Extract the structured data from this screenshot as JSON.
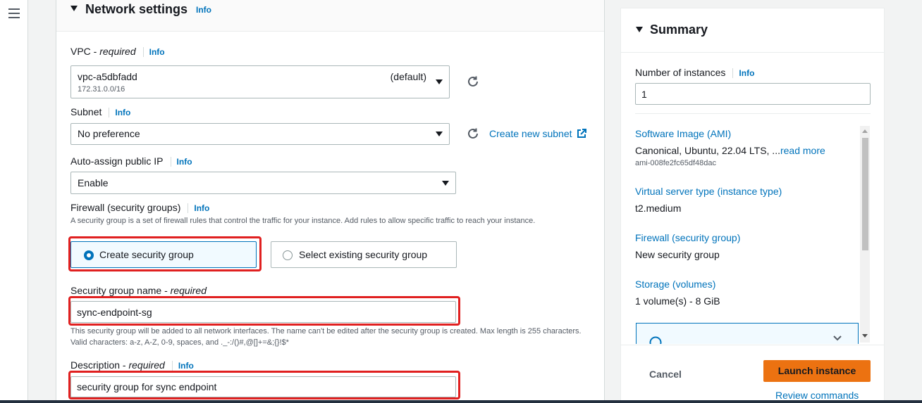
{
  "network": {
    "title": "Network settings",
    "info": "Info",
    "vpc": {
      "label": "VPC - ",
      "required": "required",
      "info": "Info",
      "value": "vpc-a5dbfadd",
      "tag": "(default)",
      "cidr": "172.31.0.0/16"
    },
    "subnet": {
      "label": "Subnet",
      "info": "Info",
      "value": "No preference",
      "create_link": "Create new subnet"
    },
    "public_ip": {
      "label": "Auto-assign public IP",
      "info": "Info",
      "value": "Enable"
    },
    "firewall": {
      "label": "Firewall (security groups)",
      "info": "Info",
      "help": "A security group is a set of firewall rules that control the traffic for your instance. Add rules to allow specific traffic to reach your instance.",
      "option_create": "Create security group",
      "option_select": "Select existing security group"
    },
    "sg_name": {
      "label": "Security group name - ",
      "required": "required",
      "value": "sync-endpoint-sg",
      "help": "This security group will be added to all network interfaces. The name can't be edited after the security group is created. Max length is 255 characters. Valid characters: a-z, A-Z, 0-9, spaces, and ._-:/()#,@[]+=&;{}!$*"
    },
    "description": {
      "label": "Description - ",
      "required": "required",
      "info": "Info",
      "value": "security group for sync endpoint"
    }
  },
  "summary": {
    "title": "Summary",
    "instances_label": "Number of instances",
    "instances_info": "Info",
    "instances_value": "1",
    "ami_title": "Software Image (AMI)",
    "ami_value": "Canonical, Ubuntu, 22.04 LTS, ...",
    "ami_read_more": "read more",
    "ami_id": "ami-008fe2fc65df48dac",
    "type_title": "Virtual server type (instance type)",
    "type_value": "t2.medium",
    "firewall_title": "Firewall (security group)",
    "firewall_value": "New security group",
    "storage_title": "Storage (volumes)",
    "storage_value": "1 volume(s) - 8 GiB",
    "cancel": "Cancel",
    "launch": "Launch instance",
    "review": "Review commands"
  },
  "colors": {
    "accent": "#0073bb",
    "launch": "#ec7211",
    "highlight": "#e02020"
  }
}
